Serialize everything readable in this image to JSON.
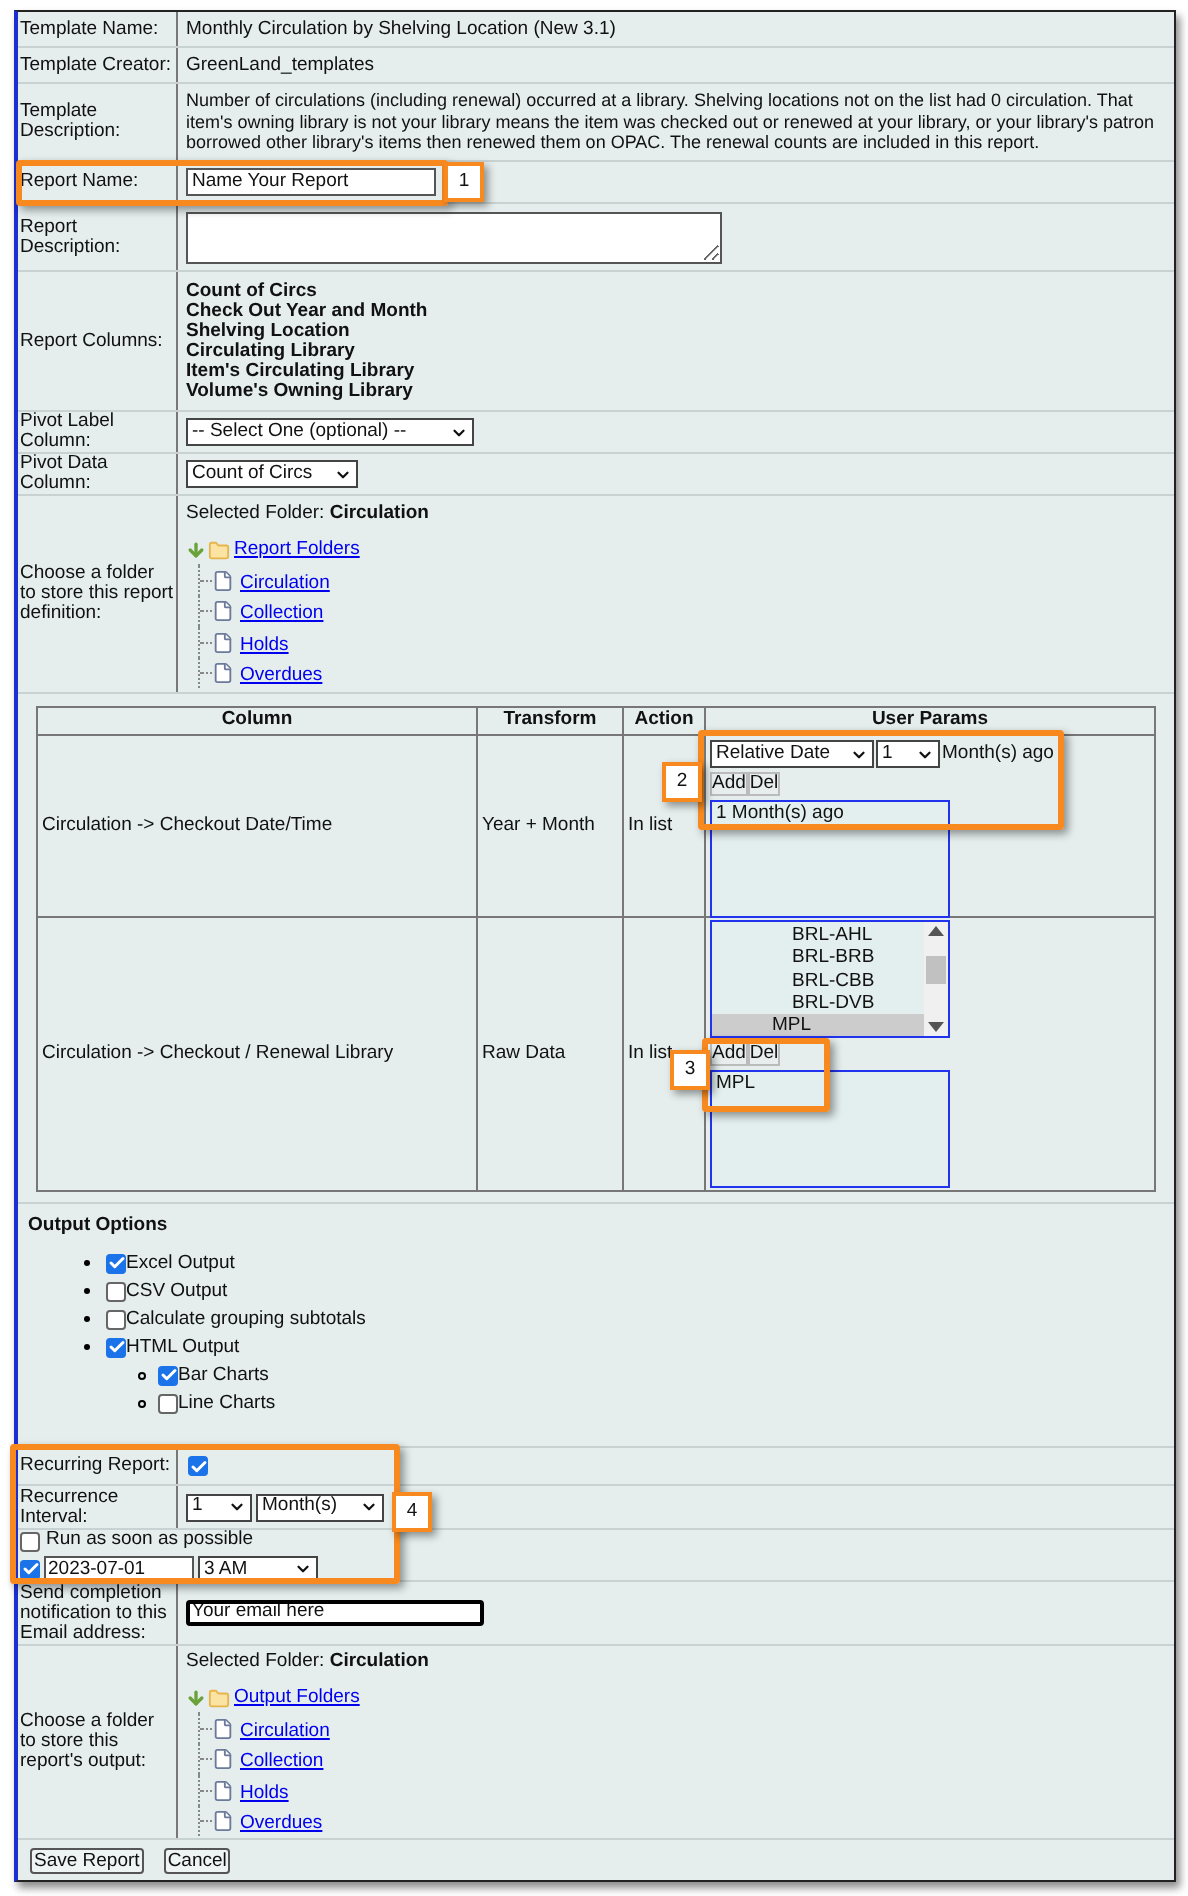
{
  "info_rows": [
    {
      "label": "Template Name:",
      "value": "Monthly Circulation by Shelving Location (New 3.1)"
    },
    {
      "label": "Template Creator:",
      "value": "GreenLand_templates"
    },
    {
      "label": "Template Description:",
      "value": "Number of circulations (including renewal) occurred at a library. Shelving locations not on the list had 0 circulation. That item's owning library is not your library means the item was checked out or renewed at your library, or your library's patron borrowed other library's items then renewed them on OPAC. The renewal counts are included in this report."
    }
  ],
  "report_name": {
    "label": "Report Name:",
    "value": "Name Your Report"
  },
  "report_description": {
    "label": "Report Description:"
  },
  "report_columns": {
    "label": "Report Columns:",
    "items": [
      "Count of Circs",
      "Check Out Year and Month",
      "Shelving Location",
      "Circulating Library",
      "Item's Circulating Library",
      "Volume's Owning Library"
    ]
  },
  "pivot_label": {
    "label": "Pivot Label Column:",
    "value": "-- Select One (optional) --"
  },
  "pivot_data": {
    "label": "Pivot Data Column:",
    "value": "Count of Circs"
  },
  "report_folder": {
    "label": "Choose a folder to store this report definition:",
    "selected_prefix": "Selected Folder:",
    "selected": "Circulation",
    "root": "Report Folders",
    "children": [
      {
        "label": "Circulation"
      },
      {
        "label": "Collection"
      },
      {
        "label": "Holds"
      },
      {
        "label": "Overdues"
      }
    ]
  },
  "params_table": {
    "columns": [
      "Column",
      "Transform",
      "Action",
      "User Params"
    ],
    "rows": [
      {
        "kind": "relative_date",
        "column": "Circulation -> Checkout Date/Time",
        "transform": "Year + Month",
        "action": "In list",
        "date_type": "Relative Date",
        "count": "1",
        "unit": "Month(s) ago",
        "add": "Add",
        "del": "Del",
        "list_items": [
          "1 Month(s) ago"
        ]
      },
      {
        "kind": "org_list",
        "column": "Circulation -> Checkout / Renewal Library",
        "transform": "Raw Data",
        "action": "In list",
        "options": [
          {
            "label": "BRL-AHL",
            "selected": false
          },
          {
            "label": "BRL-BRB",
            "selected": false
          },
          {
            "label": "BRL-CBB",
            "selected": false
          },
          {
            "label": "BRL-DVB",
            "selected": false
          },
          {
            "label": "MPL",
            "selected": true
          }
        ],
        "add": "Add",
        "del": "Del",
        "list_items": [
          "MPL"
        ]
      }
    ]
  },
  "output_options": {
    "title": "Output Options",
    "items": [
      {
        "label": "Excel Output",
        "checked": true
      },
      {
        "label": "CSV Output",
        "checked": false
      },
      {
        "label": "Calculate grouping subtotals",
        "checked": false
      },
      {
        "label": "HTML Output",
        "checked": true,
        "children": [
          {
            "label": "Bar Charts",
            "checked": true
          },
          {
            "label": "Line Charts",
            "checked": false
          }
        ]
      }
    ]
  },
  "recurring": {
    "label": "Recurring Report:",
    "checked": true
  },
  "interval": {
    "label": "Recurrence Interval:",
    "count": "1",
    "unit": "Month(s)"
  },
  "run_asap": {
    "label": "Run as soon as possible",
    "checked": false
  },
  "schedule": {
    "checked": true,
    "date": "2023-07-01",
    "time": "3 AM"
  },
  "email": {
    "label": "Send completion notification to this Email address:",
    "value": "Your email here"
  },
  "output_folder": {
    "label": "Choose a folder to store this report's output:",
    "selected_prefix": "Selected Folder:",
    "selected": "Circulation",
    "root": "Output Folders",
    "children": [
      {
        "label": "Circulation"
      },
      {
        "label": "Collection"
      },
      {
        "label": "Holds"
      },
      {
        "label": "Overdues"
      }
    ]
  },
  "buttons": [
    "Save Report",
    "Cancel"
  ],
  "callouts": [
    {
      "label": "1"
    },
    {
      "label": "2"
    },
    {
      "label": "3"
    },
    {
      "label": "4"
    }
  ]
}
